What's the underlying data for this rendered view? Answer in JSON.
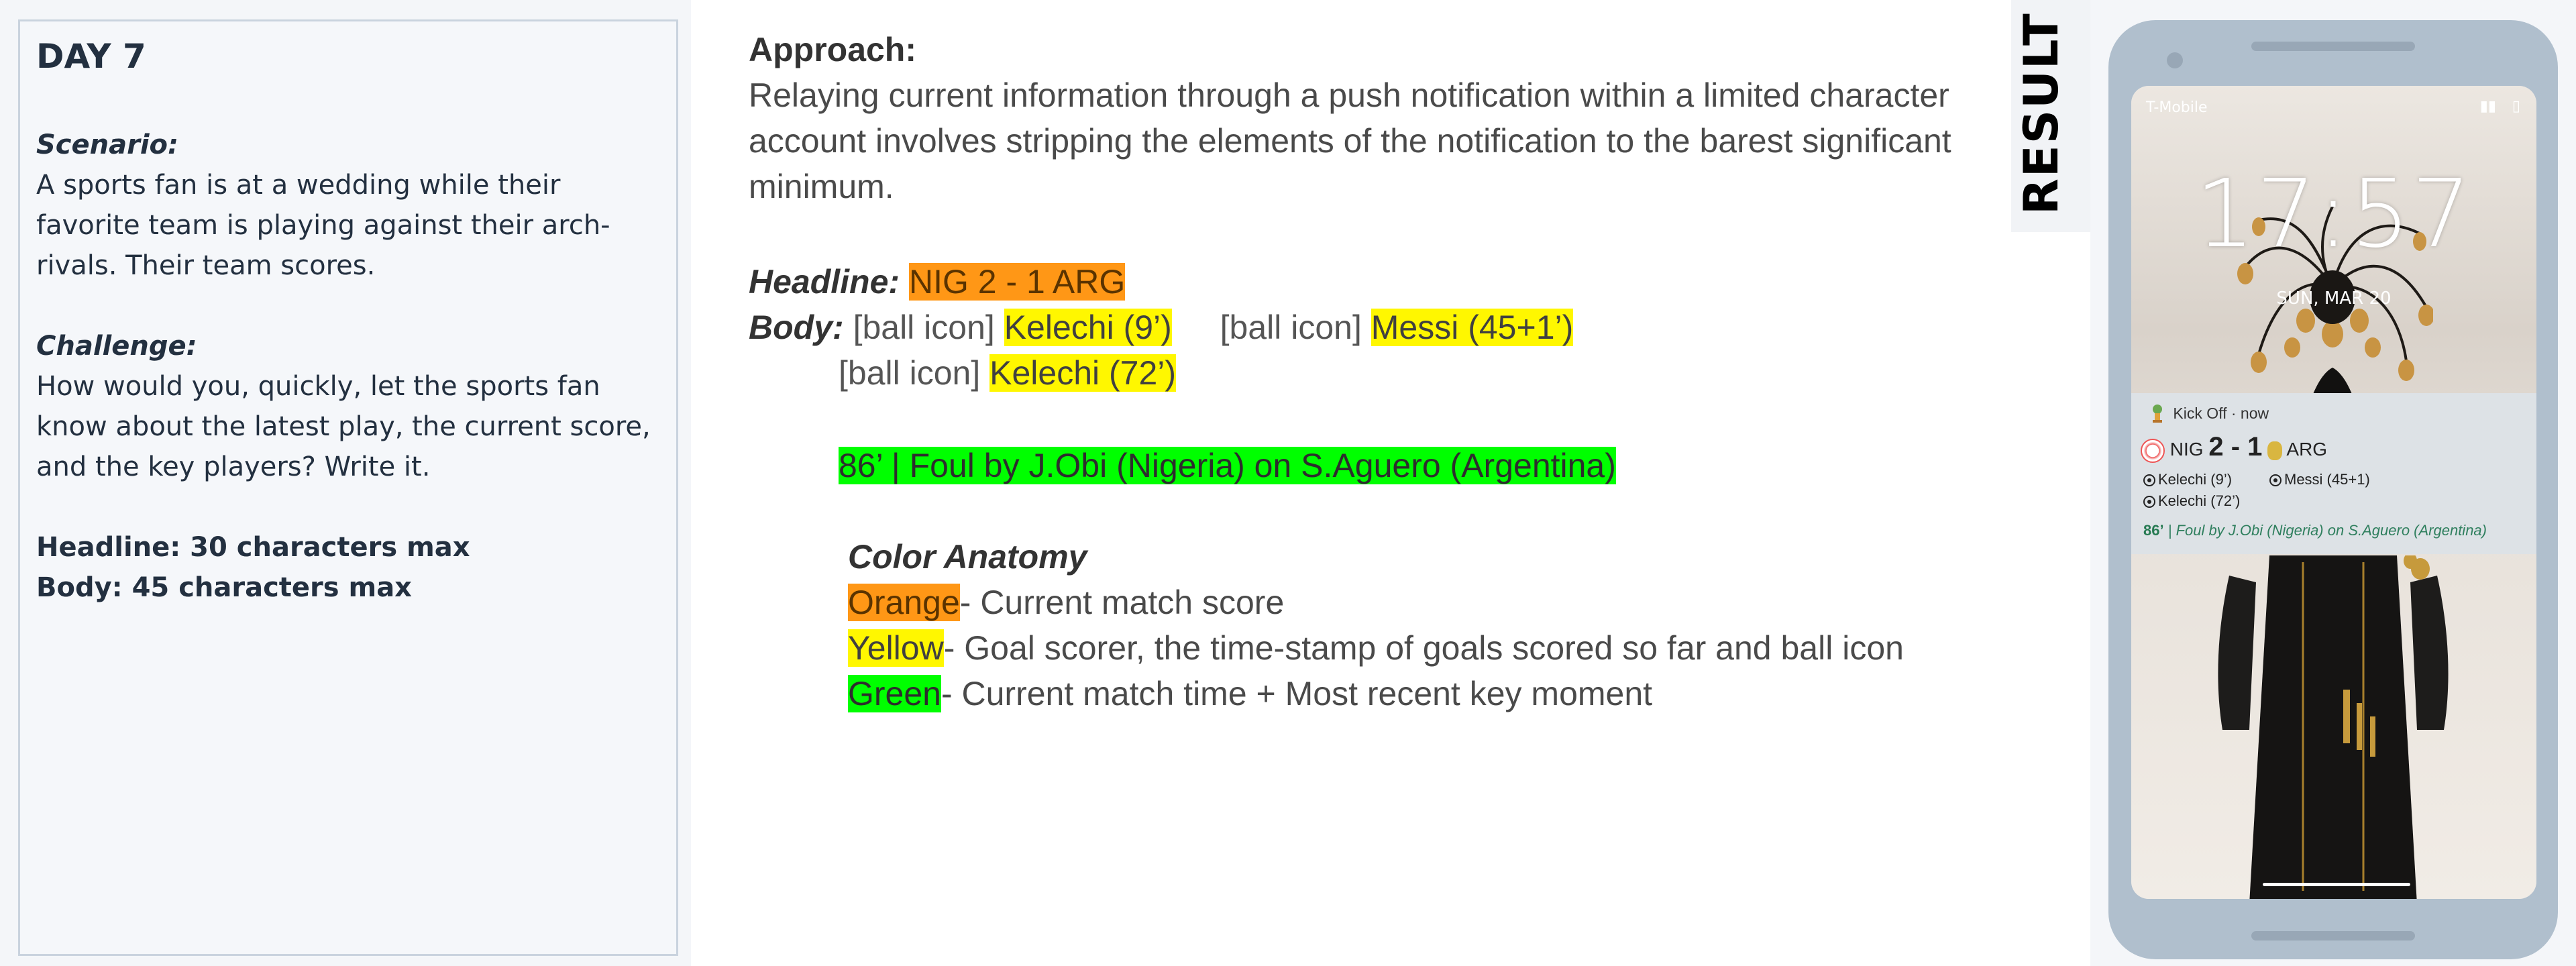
{
  "brief": {
    "day": "DAY 7",
    "scenario_label": "Scenario:",
    "scenario_text": "A sports fan is at a wedding while their favorite team is playing against their arch-rivals. Their team scores.",
    "challenge_label": "Challenge:",
    "challenge_text": "How would you, quickly, let the sports fan know about the latest play, the current score, and the key players? Write it.",
    "headline_limit": "Headline: 30 characters max",
    "body_limit": "Body: 45 characters max"
  },
  "approach": {
    "heading": "Approach:",
    "text": "Relaying current information through a push notification within a limited character account involves stripping the elements of the notification to the barest significant minimum.",
    "headline_label": "Headline:",
    "headline_value": "NIG 2 - 1 ARG",
    "body_label": "Body:",
    "ball_icon_text": "[ball icon]",
    "goal1": "Kelechi (9’)",
    "goal2": "Messi (45+1’)",
    "goal3": "Kelechi (72’)",
    "key_moment": "86’ | Foul by J.Obi (Nigeria) on S.Aguero (Argentina)",
    "anatomy_heading": "Color Anatomy",
    "anatomy": [
      {
        "color_name": "Orange",
        "desc": "- Current match score",
        "color": "#ff9716"
      },
      {
        "color_name": "Yellow",
        "desc": "- Goal scorer, the time-stamp of goals scored so far and ball icon",
        "color": "#fff700"
      },
      {
        "color_name": "Green",
        "desc": "-  Current match time + Most recent key moment",
        "color": "#00ff00"
      }
    ]
  },
  "result_label": "RESULT",
  "phone": {
    "carrier": "T-Mobile",
    "time": "17:57",
    "date": "SUN, MAR 20",
    "notification": {
      "app": "Kick Off · now",
      "home": "NIG",
      "score": "2 - 1",
      "away": "ARG",
      "goal1": "Kelechi (9’)",
      "goal2": "Messi (45+1)",
      "goal3": "Kelechi (72’)",
      "minute": "86’",
      "separator": "|",
      "moment": "Foul by J.Obi (Nigeria) on S.Aguero (Argentina)"
    }
  }
}
